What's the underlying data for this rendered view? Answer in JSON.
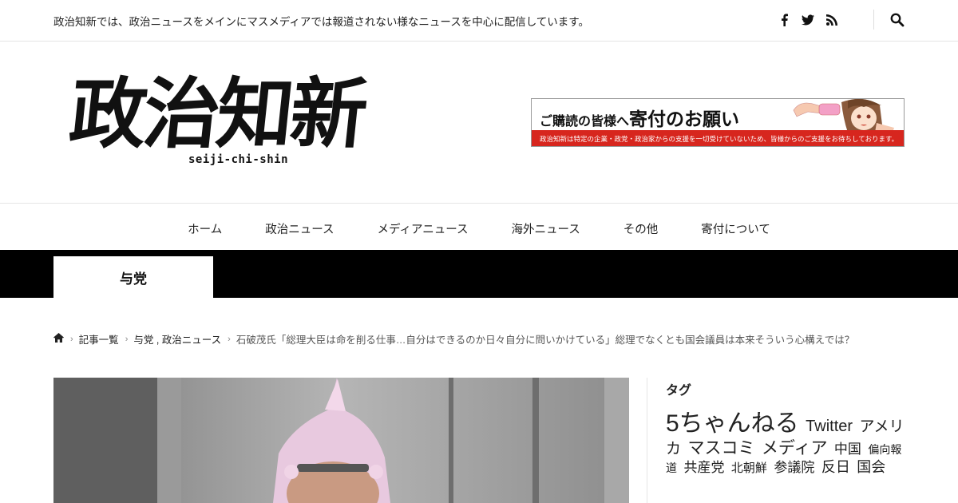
{
  "topbar": {
    "description": "政治知新では、政治ニュースをメインにマスメディアでは報道されない様なニュースを中心に配信しています。",
    "social_icons": [
      "facebook-icon",
      "twitter-icon",
      "rss-icon"
    ],
    "search_icon": "search-icon"
  },
  "logo": {
    "kanji": "政治知新",
    "romaji": "seiji-chi-shin"
  },
  "banner": {
    "title_small": "ご購読の皆様へ",
    "title_big": "寄付のお願い",
    "strip": "政治知新は特定の企業・政党・政治家からの支援を一切受けていないため、皆様からのご支援をお待ちしております。",
    "accent_color": "#d7261e"
  },
  "nav": {
    "items": [
      "ホーム",
      "政治ニュース",
      "メディアニュース",
      "海外ニュース",
      "その他",
      "寄付について"
    ]
  },
  "category_tab": "与党",
  "breadcrumb": {
    "home_icon": "home-icon",
    "items": [
      "記事一覧",
      "与党 , 政治ニュース"
    ],
    "current": "石破茂氏「総理大臣は命を削る仕事…自分はできるのか日々自分に問いかけている」総理でなくとも国会議員は本来そういう心構えでは？"
  },
  "sidebar": {
    "heading": "タグ",
    "tags": [
      "5ちゃんねる",
      "Twitter",
      "アメリカ",
      "マスコミ",
      "メディア",
      "中国",
      "偏向報道",
      "共産党",
      "北朝鮮",
      "参議院",
      "反日",
      "国会"
    ]
  }
}
